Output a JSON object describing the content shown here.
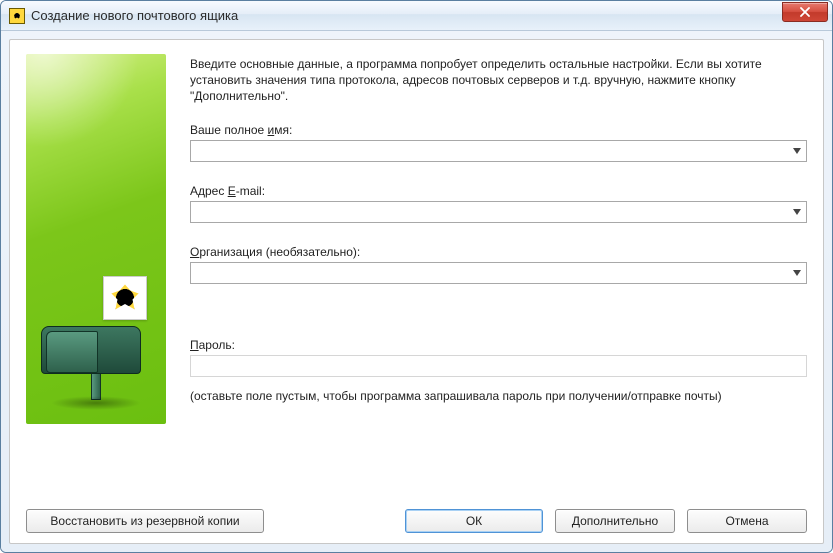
{
  "window": {
    "title": "Создание нового почтового ящика"
  },
  "intro": "Введите основные данные, а программа попробует определить остальные настройки. Если вы хотите установить значения типа протокола, адресов почтовых серверов и т.д. вручную, нажмите кнопку \"Дополнительно\".",
  "fields": {
    "fullname": {
      "label_pre": "Ваше полное ",
      "label_ul": "и",
      "label_post": "мя:",
      "value": ""
    },
    "email": {
      "label_pre": "Адрес ",
      "label_ul": "E",
      "label_post": "-mail:",
      "value": ""
    },
    "org": {
      "label_pre": "",
      "label_ul": "О",
      "label_post": "рганизация (необязательно):",
      "value": ""
    },
    "password": {
      "label_pre": "",
      "label_ul": "П",
      "label_post": "ароль:",
      "value": ""
    }
  },
  "hint": "(оставьте поле пустым, чтобы программа запрашивала пароль при получении/отправке почты)",
  "buttons": {
    "restore": "Восстановить из резервной копии",
    "ok": "ОК",
    "advanced": "Дополнительно",
    "cancel": "Отмена"
  }
}
